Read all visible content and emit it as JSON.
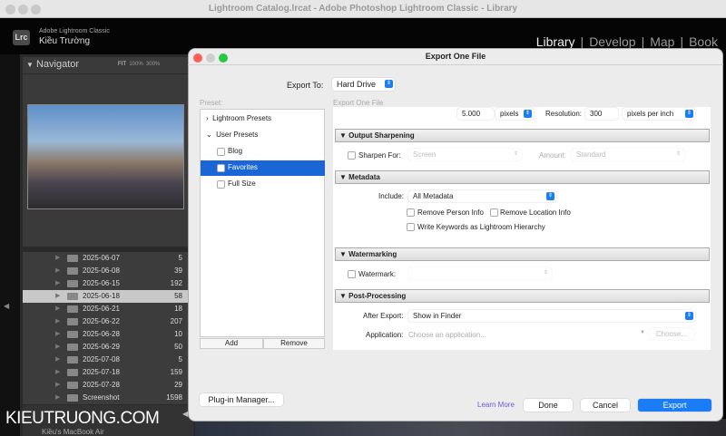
{
  "window": {
    "title": "Lightroom Catalog.lrcat - Adobe Photoshop Lightroom Classic - Library"
  },
  "header": {
    "logo": "Lrc",
    "app": "Adobe Lightroom Classic",
    "user": "Kiều Trường",
    "modules": [
      "Library",
      "Develop",
      "Map",
      "Book"
    ],
    "separator": "|"
  },
  "navigator": {
    "title": "Navigator",
    "zoom": [
      "FIT",
      "100%",
      "300%"
    ]
  },
  "folders": [
    {
      "name": "2025-06-07",
      "count": "5"
    },
    {
      "name": "2025-06-08",
      "count": "39"
    },
    {
      "name": "2025-06-15",
      "count": "192"
    },
    {
      "name": "2025-06-18",
      "count": "58",
      "selected": true
    },
    {
      "name": "2025-06-21",
      "count": "18"
    },
    {
      "name": "2025-06-22",
      "count": "207"
    },
    {
      "name": "2025-06-28",
      "count": "10"
    },
    {
      "name": "2025-06-29",
      "count": "50"
    },
    {
      "name": "2025-07-08",
      "count": "5"
    },
    {
      "name": "2025-07-18",
      "count": "159"
    },
    {
      "name": "2025-07-28",
      "count": "29"
    },
    {
      "name": "Screenshot",
      "count": "1598"
    }
  ],
  "volume": "Kiều's MacBook Air",
  "watermark": "KIEUTRUONG.COM",
  "dialog": {
    "title": "Export One File",
    "export_to_label": "Export To:",
    "export_to": "Hard Drive",
    "preset_label": "Preset:",
    "section_label": "Export One File",
    "presets": [
      {
        "label": "Lightroom Presets",
        "type": "folder",
        "expanded": false
      },
      {
        "label": "User Presets",
        "type": "folder",
        "expanded": true
      },
      {
        "label": "Blog"
      },
      {
        "label": "Favorites",
        "selected": true
      },
      {
        "label": "Full Size"
      }
    ],
    "add": "Add",
    "remove": "Remove",
    "size": {
      "value": "5.000",
      "unit": "pixels",
      "resolution_label": "Resolution:",
      "resolution": "300",
      "resolution_unit": "pixels per inch"
    },
    "sharpening": {
      "title": "Output Sharpening",
      "sharpen_for": "Sharpen For:",
      "sharpen_value": "Screen",
      "amount_label": "Amount:",
      "amount": "Standard"
    },
    "metadata": {
      "title": "Metadata",
      "include_label": "Include:",
      "include": "All Metadata",
      "remove_person": "Remove Person Info",
      "remove_location": "Remove Location Info",
      "write_keywords": "Write Keywords as Lightroom Hierarchy"
    },
    "watermarking": {
      "title": "Watermarking",
      "label": "Watermark:"
    },
    "post": {
      "title": "Post-Processing",
      "after_label": "After Export:",
      "after": "Show in Finder",
      "app_label": "Application:",
      "app_placeholder": "Choose an application...",
      "choose": "Choose..."
    },
    "plugin": "Plug-in Manager...",
    "learn_more": "Learn More",
    "done": "Done",
    "cancel": "Cancel",
    "export": "Export"
  }
}
